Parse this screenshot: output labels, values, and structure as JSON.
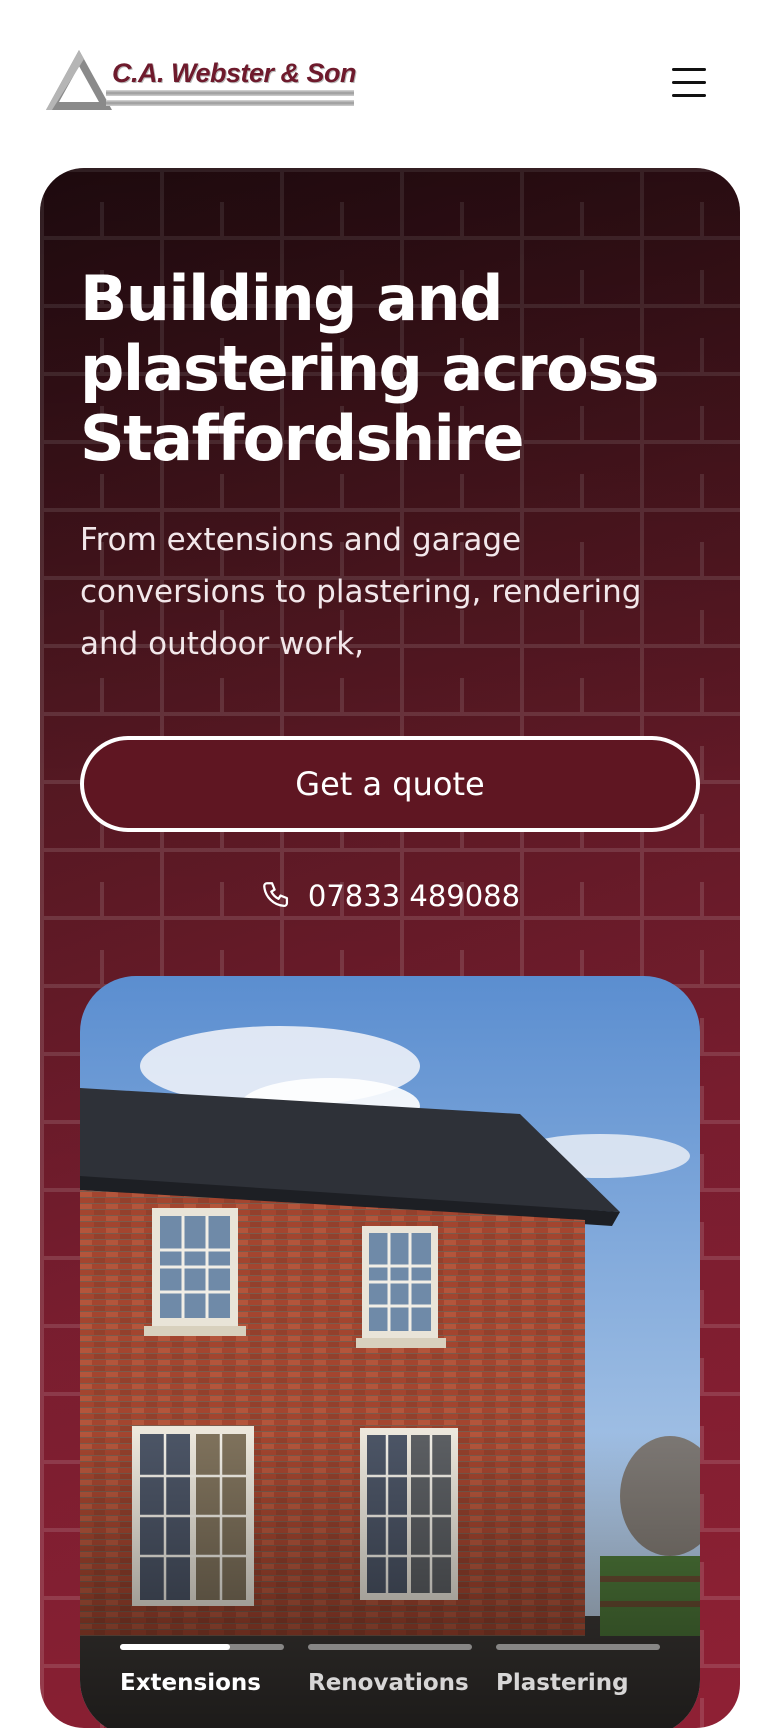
{
  "header": {
    "logo_text": "C.A. Webster & Son",
    "menu_icon": "hamburger-menu-icon"
  },
  "hero": {
    "title": "Building and plastering across Staffordshire",
    "subtitle": "From extensions and garage conversions to plastering, rendering and outdoor work,",
    "cta_label": "Get a quote",
    "phone_icon": "phone-icon",
    "phone_number": "07833 489088"
  },
  "carousel": {
    "active_progress": 0.67,
    "tabs": [
      {
        "label": "Extensions",
        "active": true
      },
      {
        "label": "Renovations",
        "active": false
      },
      {
        "label": "Plastering",
        "active": false
      }
    ]
  },
  "colors": {
    "brand": "#6e1a2c",
    "hero_dark": "#2d0f15",
    "hero_light": "#8f2034",
    "button_bg": "#5f1622"
  }
}
